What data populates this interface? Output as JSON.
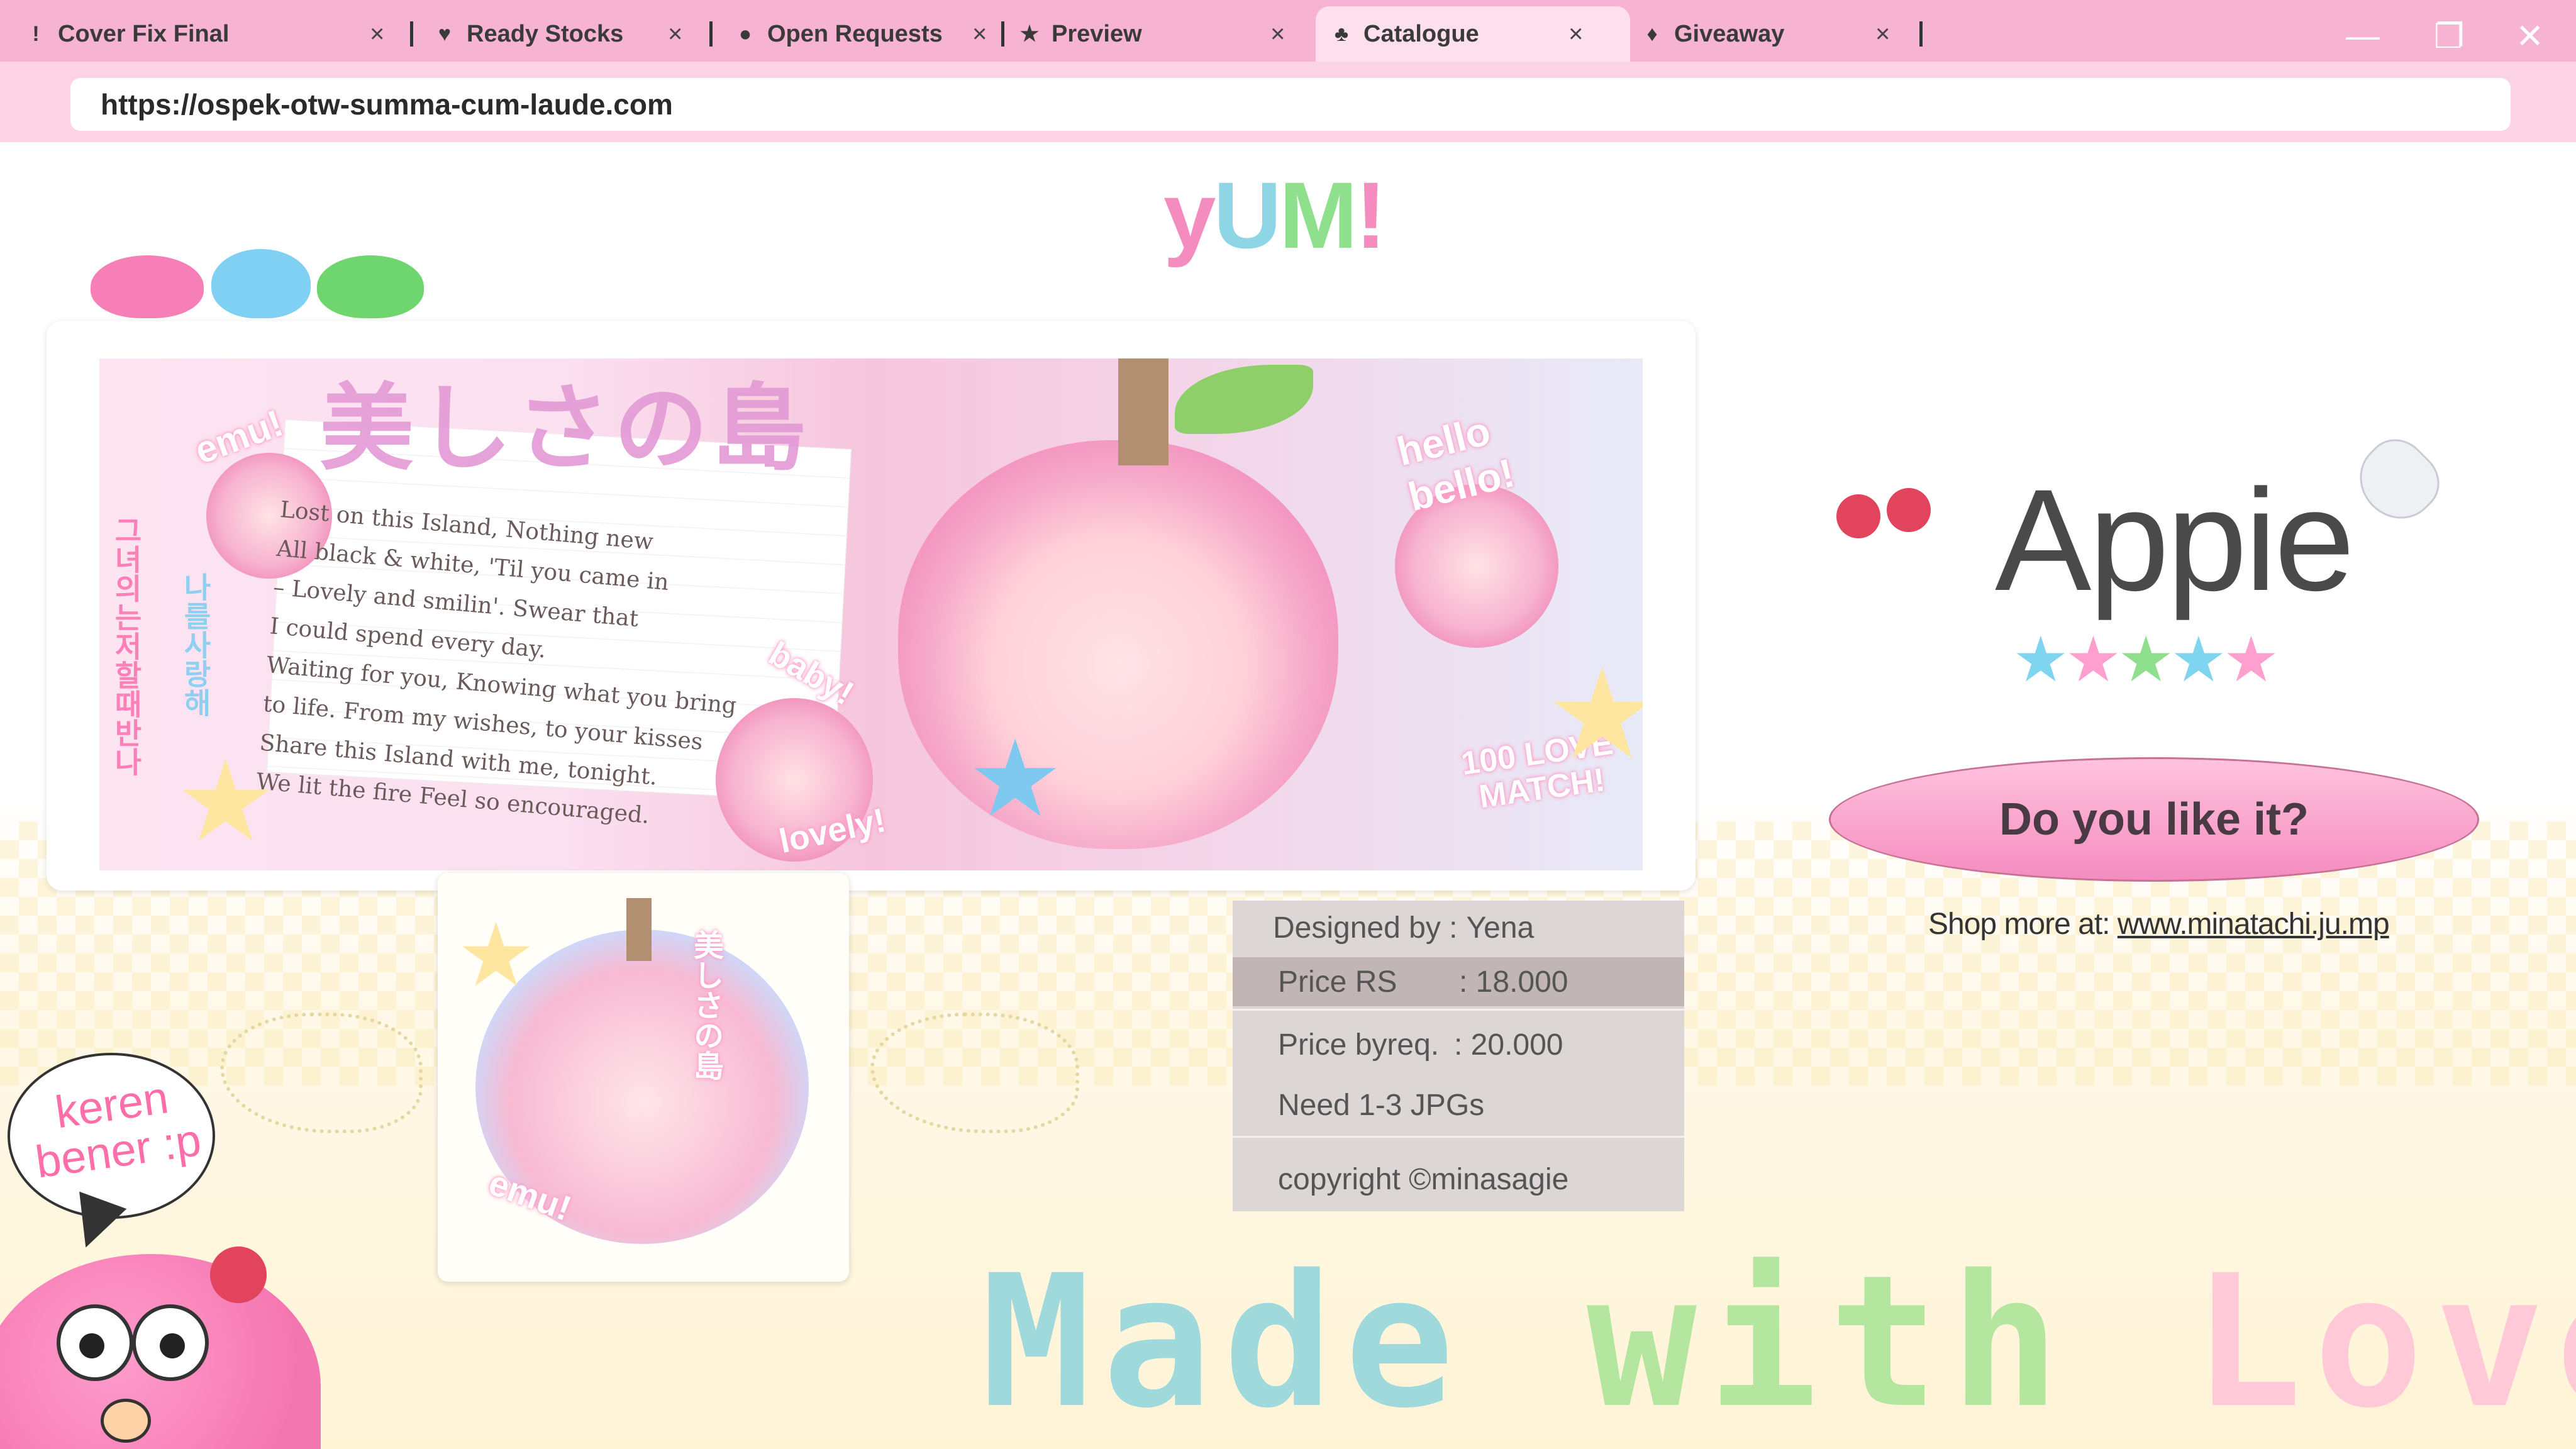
{
  "browser": {
    "tabs": [
      {
        "label": "Cover Fix Final",
        "icon": "exclamation-icon",
        "icon_glyph": "!",
        "active": false
      },
      {
        "label": "Ready Stocks",
        "icon": "heart-icon",
        "icon_glyph": "♥",
        "active": false
      },
      {
        "label": "Open Requests",
        "icon": "apple-icon",
        "icon_glyph": "●",
        "active": false
      },
      {
        "label": "Preview",
        "icon": "star-icon",
        "icon_glyph": "★",
        "active": false
      },
      {
        "label": "Catalogue",
        "icon": "cherry-icon",
        "icon_glyph": "♣",
        "active": true
      },
      {
        "label": "Giveaway",
        "icon": "balloon-icon",
        "icon_glyph": "♦",
        "active": false
      }
    ],
    "close_glyph": "×",
    "url": "https://ospek-otw-summa-cum-laude.com",
    "window_controls": {
      "minimize": "—",
      "restore": "❐",
      "close": "✕"
    },
    "colors": {
      "tabbar": "#f7b3d2",
      "active_tab": "#fde0ec",
      "addressbar": "#fbd3e4"
    }
  },
  "site": {
    "logo_letters": [
      "y",
      "U",
      "M",
      "!"
    ],
    "banner": {
      "title_jp": "美しさの島",
      "korean_left": "그녀의는저할때반나",
      "korean_right": "나를사랑해",
      "stickers": {
        "emu": "emu!",
        "hello": "hello bello!",
        "baby": "baby!",
        "lovely": "lovely!",
        "love_match": "100 LOVE MATCH!"
      },
      "lyrics": [
        "Lost on this Island, Nothing new",
        "All black & white, 'Til you came in",
        "– Lovely and smilin'. Swear that",
        "I could spend every day.",
        "Waiting for you, Knowing what you bring",
        "to life. From my wishes, to your kisses",
        "Share this Island with me, tonight.",
        "We lit the fire Feel so encouraged."
      ]
    },
    "icon_sticker": {
      "title_jp": "美しさの島",
      "label": "emu!"
    },
    "info": {
      "designed_label": "Designed by :",
      "designer": "Yena",
      "price_rs_label": "Price RS",
      "price_rs": ": 18.000",
      "price_byreq_label": "Price byreq.",
      "price_byreq": ": 20.000",
      "need": "Need 1-3 JPGs",
      "copyright": "copyright ©minasagie"
    },
    "product": {
      "name": "Appie",
      "rating": 5,
      "star_colors": [
        "#7fd4f0",
        "#ff9fd0",
        "#8fe08c",
        "#7fd4f0",
        "#ff9fd0"
      ],
      "like_button": "Do you like it?",
      "shop_prefix": "Shop more at:",
      "shop_link": "www.minatachi.ju.mp"
    },
    "bubble_text": "keren bener :p",
    "footer_art": {
      "m1": "Made",
      "m2": "with",
      "m3": "Love"
    }
  }
}
